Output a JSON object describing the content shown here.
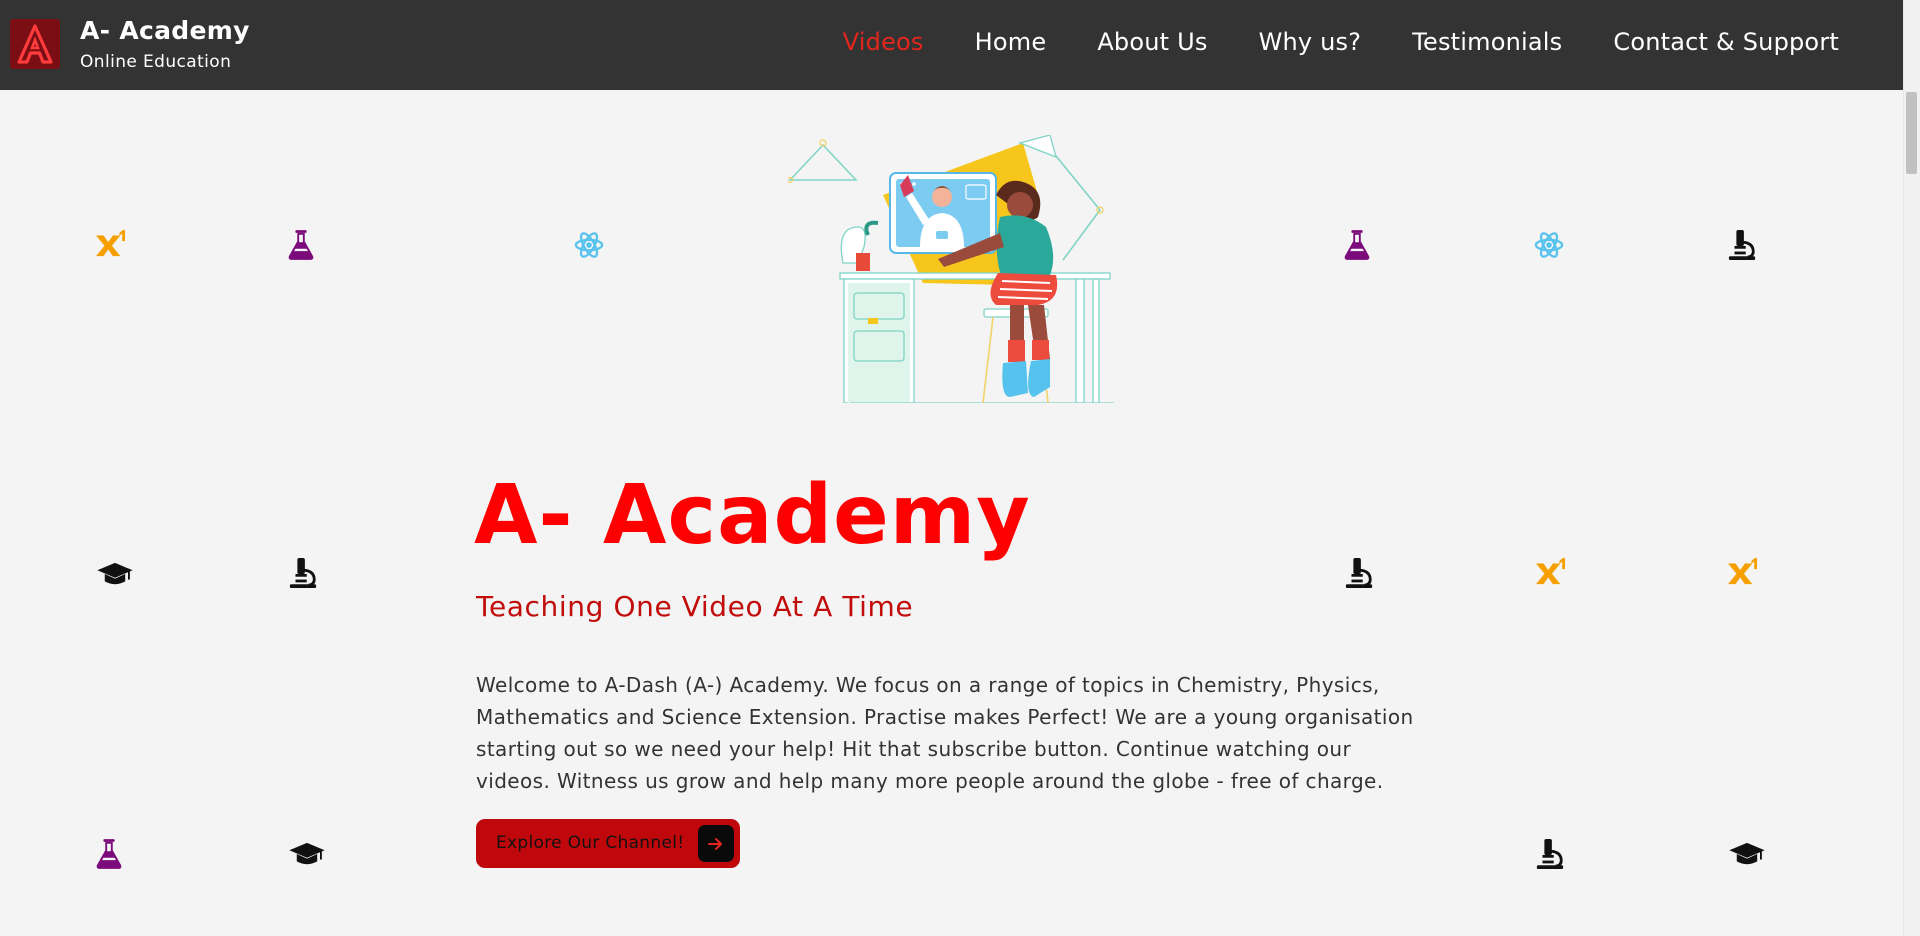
{
  "header": {
    "brand_title": "A- Academy",
    "brand_subtitle": "Online Education",
    "nav": [
      {
        "label": "Videos",
        "active": true
      },
      {
        "label": "Home",
        "active": false
      },
      {
        "label": "About Us",
        "active": false
      },
      {
        "label": "Why us?",
        "active": false
      },
      {
        "label": "Testimonials",
        "active": false
      },
      {
        "label": "Contact & Support",
        "active": false
      }
    ]
  },
  "hero": {
    "title": "A- Academy",
    "subtitle": "Teaching One Video At A Time",
    "description": "Welcome to A-Dash (A-) Academy. We focus on a range of topics in Chemistry, Physics, Mathematics and Science Extension. Practise makes Perfect! We are a young organisation starting out so we need your help! Hit that subscribe button. Continue watching our videos. Witness us grow and help many more people around the globe - free of charge.",
    "cta_label": "Explore Our Channel!"
  },
  "decor_icons": [
    "superscript-icon",
    "flask-icon",
    "atom-icon",
    "microscope-icon",
    "graduation-cap-icon"
  ],
  "colors": {
    "navbar_bg": "#333333",
    "active_nav": "#e3261d",
    "title": "#ff0000",
    "subtitle": "#c20d0d",
    "cta_bg": "#c0080c",
    "superscript_icon": "#f5a000",
    "flask_icon": "#7b0a7b",
    "atom_icon": "#55c3ee",
    "microscope_icon": "#111111"
  }
}
